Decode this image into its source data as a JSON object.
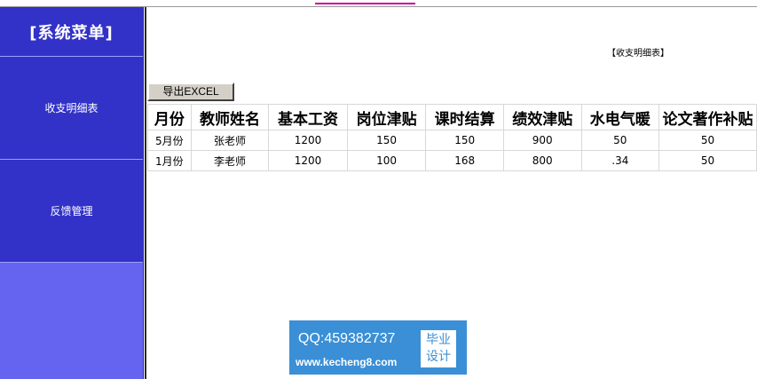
{
  "sidebar": {
    "title": "[系统菜单]",
    "items": [
      {
        "label": "收支明细表"
      },
      {
        "label": "反馈管理"
      }
    ]
  },
  "main": {
    "heading": "【收支明细表】",
    "export_label": "导出EXCEL",
    "table": {
      "headers": [
        "月份",
        "教师姓名",
        "基本工资",
        "岗位津贴",
        "课时结算",
        "绩效津贴",
        "水电气暖",
        "论文著作补贴"
      ],
      "rows": [
        [
          "5月份",
          "张老师",
          "1200",
          "150",
          "150",
          "900",
          "50",
          "50"
        ],
        [
          "1月份",
          "李老师",
          "1200",
          "100",
          "168",
          "800",
          ".34",
          "50"
        ]
      ]
    }
  },
  "watermark": {
    "qq": "QQ:459382737",
    "url": "www.kecheng8.com",
    "badge": "毕业设计"
  },
  "colors": {
    "sidebar_block": "#3232c8",
    "sidebar_bg": "#6464f0",
    "watermark": "#3a8fd6"
  }
}
